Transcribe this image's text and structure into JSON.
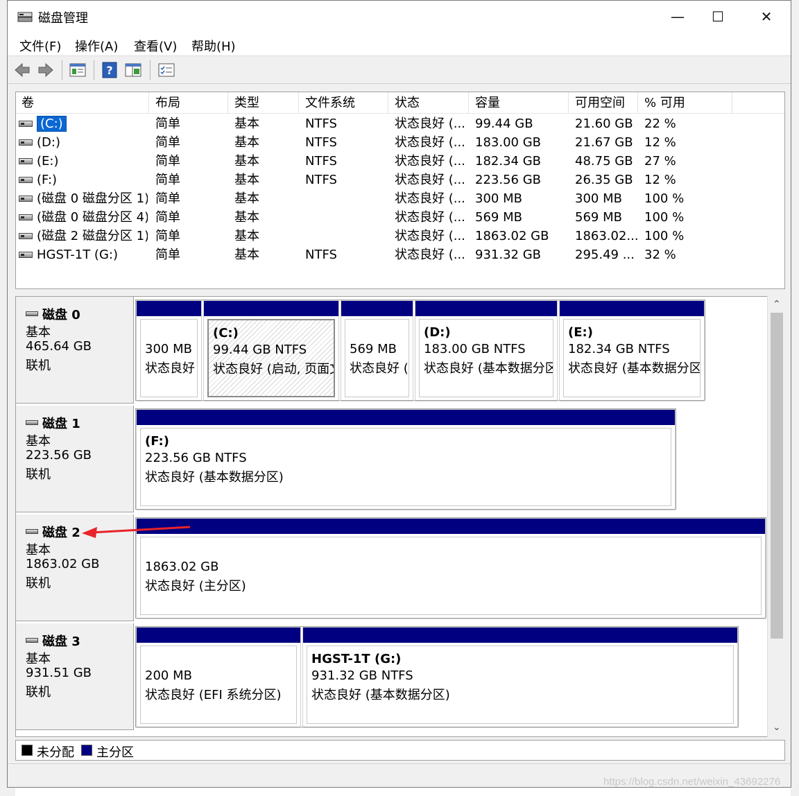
{
  "window": {
    "title": "磁盘管理",
    "minimize_glyph": "—",
    "maximize_glyph": "☐",
    "close_glyph": "✕"
  },
  "menu": [
    "文件(F)",
    "操作(A)",
    "查看(V)",
    "帮助(H)"
  ],
  "toolbar": [
    "back-icon",
    "forward-icon",
    "properties-icon",
    "help-icon",
    "view-icon",
    "checklist-icon"
  ],
  "volume_table": {
    "columns": [
      "卷",
      "布局",
      "类型",
      "文件系统",
      "状态",
      "容量",
      "可用空间",
      "% 可用"
    ],
    "rows": [
      {
        "name": "(C:)",
        "layout": "简单",
        "type": "基本",
        "fs": "NTFS",
        "status": "状态良好 (...",
        "capacity": "99.44 GB",
        "free": "21.60 GB",
        "pct": "22 %"
      },
      {
        "name": "(D:)",
        "layout": "简单",
        "type": "基本",
        "fs": "NTFS",
        "status": "状态良好 (...",
        "capacity": "183.00 GB",
        "free": "21.67 GB",
        "pct": "12 %"
      },
      {
        "name": "(E:)",
        "layout": "简单",
        "type": "基本",
        "fs": "NTFS",
        "status": "状态良好 (...",
        "capacity": "182.34 GB",
        "free": "48.75 GB",
        "pct": "27 %"
      },
      {
        "name": "(F:)",
        "layout": "简单",
        "type": "基本",
        "fs": "NTFS",
        "status": "状态良好 (...",
        "capacity": "223.56 GB",
        "free": "26.35 GB",
        "pct": "12 %"
      },
      {
        "name": "(磁盘 0 磁盘分区 1)",
        "layout": "简单",
        "type": "基本",
        "fs": "",
        "status": "状态良好 (...",
        "capacity": "300 MB",
        "free": "300 MB",
        "pct": "100 %"
      },
      {
        "name": "(磁盘 0 磁盘分区 4)",
        "layout": "简单",
        "type": "基本",
        "fs": "",
        "status": "状态良好 (...",
        "capacity": "569 MB",
        "free": "569 MB",
        "pct": "100 %"
      },
      {
        "name": "(磁盘 2 磁盘分区 1)",
        "layout": "简单",
        "type": "基本",
        "fs": "",
        "status": "状态良好 (...",
        "capacity": "1863.02 GB",
        "free": "1863.02...",
        "pct": "100 %"
      },
      {
        "name": "HGST-1T (G:)",
        "layout": "简单",
        "type": "基本",
        "fs": "NTFS",
        "status": "状态良好 (...",
        "capacity": "931.32 GB",
        "free": "295.49 ...",
        "pct": "32 %"
      }
    ]
  },
  "disks": [
    {
      "title": "磁盘 0",
      "kind": "基本",
      "size": "465.64 GB",
      "state": "联机",
      "partitions": [
        {
          "label": "",
          "line1": "300 MB",
          "line2": "状态良好"
        },
        {
          "label": "(C:)",
          "line1": "99.44 GB NTFS",
          "line2": "状态良好 (启动, 页面文"
        },
        {
          "label": "",
          "line1": "569 MB",
          "line2": "状态良好 ("
        },
        {
          "label": "(D:)",
          "line1": "183.00 GB NTFS",
          "line2": "状态良好 (基本数据分区"
        },
        {
          "label": "(E:)",
          "line1": "182.34 GB NTFS",
          "line2": "状态良好 (基本数据分区"
        }
      ]
    },
    {
      "title": "磁盘 1",
      "kind": "基本",
      "size": "223.56 GB",
      "state": "联机",
      "partitions": [
        {
          "label": "(F:)",
          "line1": "223.56 GB NTFS",
          "line2": "状态良好 (基本数据分区)"
        }
      ]
    },
    {
      "title": "磁盘 2",
      "kind": "基本",
      "size": "1863.02 GB",
      "state": "联机",
      "partitions": [
        {
          "label": "",
          "line1": "1863.02 GB",
          "line2": "状态良好 (主分区)"
        }
      ]
    },
    {
      "title": "磁盘 3",
      "kind": "基本",
      "size": "931.51 GB",
      "state": "联机",
      "partitions": [
        {
          "label": "",
          "line1": "200 MB",
          "line2": "状态良好 (EFI 系统分区)"
        },
        {
          "label": "HGST-1T  (G:)",
          "line1": "931.32 GB NTFS",
          "line2": "状态良好 (基本数据分区)"
        }
      ]
    }
  ],
  "legend": [
    {
      "label": "未分配",
      "color": "#000000"
    },
    {
      "label": "主分区",
      "color": "#000080"
    }
  ],
  "watermark": "https://blog.csdn.net/weixin_43692276",
  "colors": {
    "partition_header": "#000080",
    "selection": "#0a67d3",
    "annotation_arrow": "#e8242a"
  }
}
